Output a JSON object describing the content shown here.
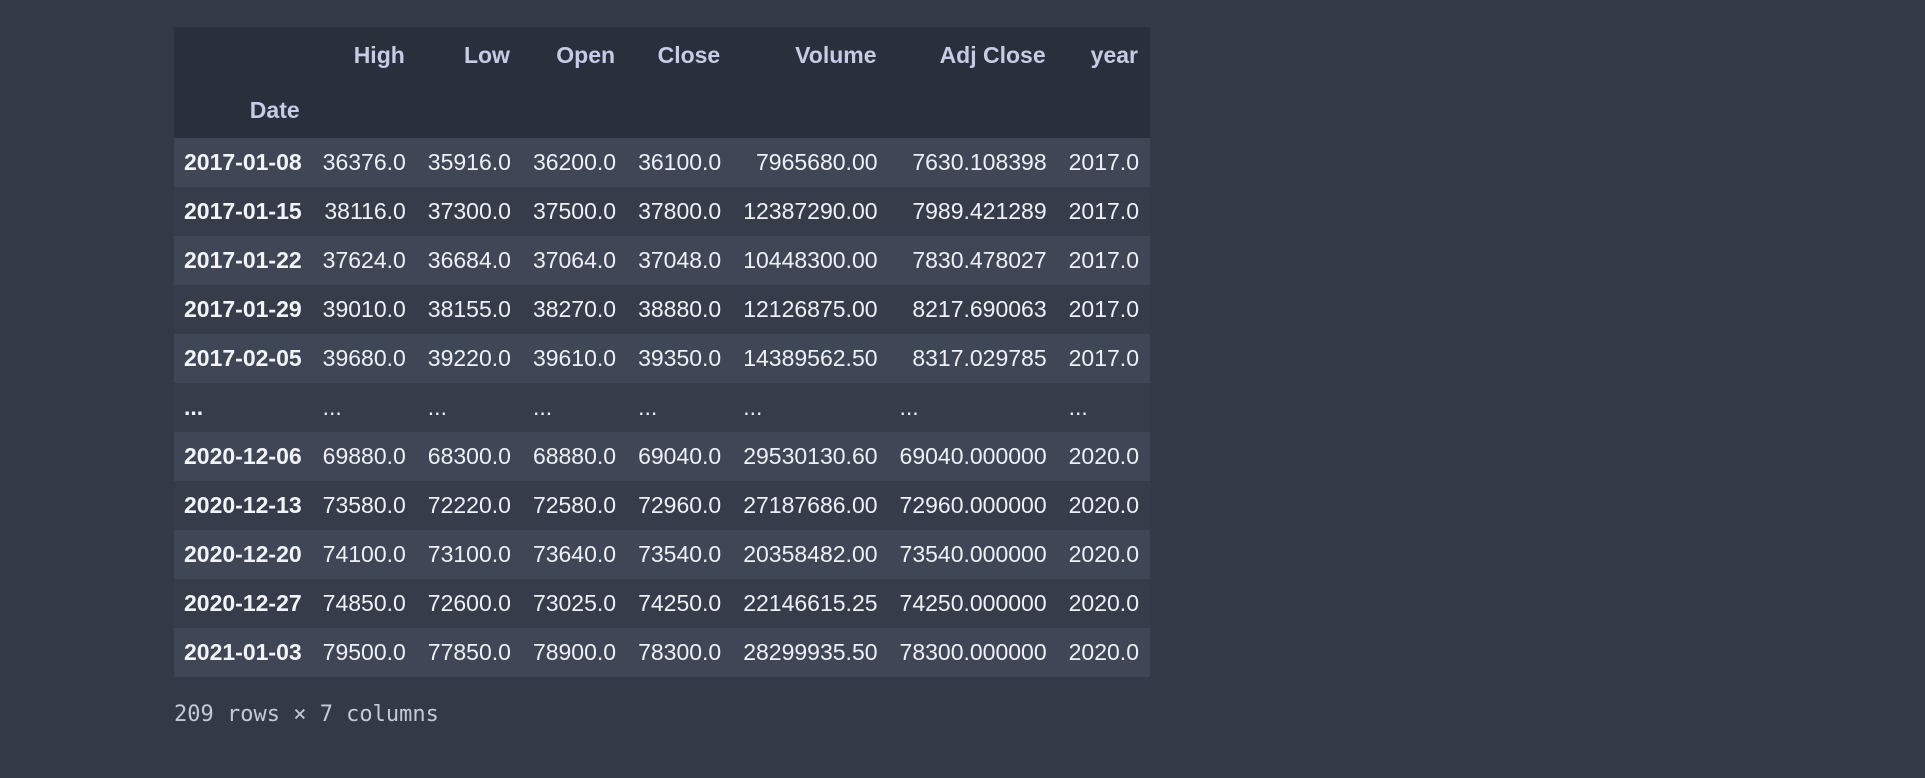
{
  "table": {
    "columns": [
      "High",
      "Low",
      "Open",
      "Close",
      "Volume",
      "Adj Close",
      "year"
    ],
    "index_name": "Date",
    "rows": [
      {
        "index": "2017-01-08",
        "values": [
          "36376.0",
          "35916.0",
          "36200.0",
          "36100.0",
          "7965680.00",
          "7630.108398",
          "2017.0"
        ]
      },
      {
        "index": "2017-01-15",
        "values": [
          "38116.0",
          "37300.0",
          "37500.0",
          "37800.0",
          "12387290.00",
          "7989.421289",
          "2017.0"
        ]
      },
      {
        "index": "2017-01-22",
        "values": [
          "37624.0",
          "36684.0",
          "37064.0",
          "37048.0",
          "10448300.00",
          "7830.478027",
          "2017.0"
        ]
      },
      {
        "index": "2017-01-29",
        "values": [
          "39010.0",
          "38155.0",
          "38270.0",
          "38880.0",
          "12126875.00",
          "8217.690063",
          "2017.0"
        ]
      },
      {
        "index": "2017-02-05",
        "values": [
          "39680.0",
          "39220.0",
          "39610.0",
          "39350.0",
          "14389562.50",
          "8317.029785",
          "2017.0"
        ]
      },
      {
        "index": "...",
        "values": [
          "...",
          "...",
          "...",
          "...",
          "...",
          "...",
          "..."
        ]
      },
      {
        "index": "2020-12-06",
        "values": [
          "69880.0",
          "68300.0",
          "68880.0",
          "69040.0",
          "29530130.60",
          "69040.000000",
          "2020.0"
        ]
      },
      {
        "index": "2020-12-13",
        "values": [
          "73580.0",
          "72220.0",
          "72580.0",
          "72960.0",
          "27187686.00",
          "72960.000000",
          "2020.0"
        ]
      },
      {
        "index": "2020-12-20",
        "values": [
          "74100.0",
          "73100.0",
          "73640.0",
          "73540.0",
          "20358482.00",
          "73540.000000",
          "2020.0"
        ]
      },
      {
        "index": "2020-12-27",
        "values": [
          "74850.0",
          "72600.0",
          "73025.0",
          "74250.0",
          "22146615.25",
          "74250.000000",
          "2020.0"
        ]
      },
      {
        "index": "2021-01-03",
        "values": [
          "79500.0",
          "77850.0",
          "78900.0",
          "78300.0",
          "28299935.50",
          "78300.000000",
          "2020.0"
        ]
      }
    ]
  },
  "shape_caption": "209 rows × 7 columns",
  "colors": {
    "background": "#333a47",
    "header_background": "#2a303b",
    "row_odd": "#3f4655",
    "row_even": "#363c4a",
    "header_text": "#c6cbe6",
    "cell_text": "#eef0f6"
  }
}
